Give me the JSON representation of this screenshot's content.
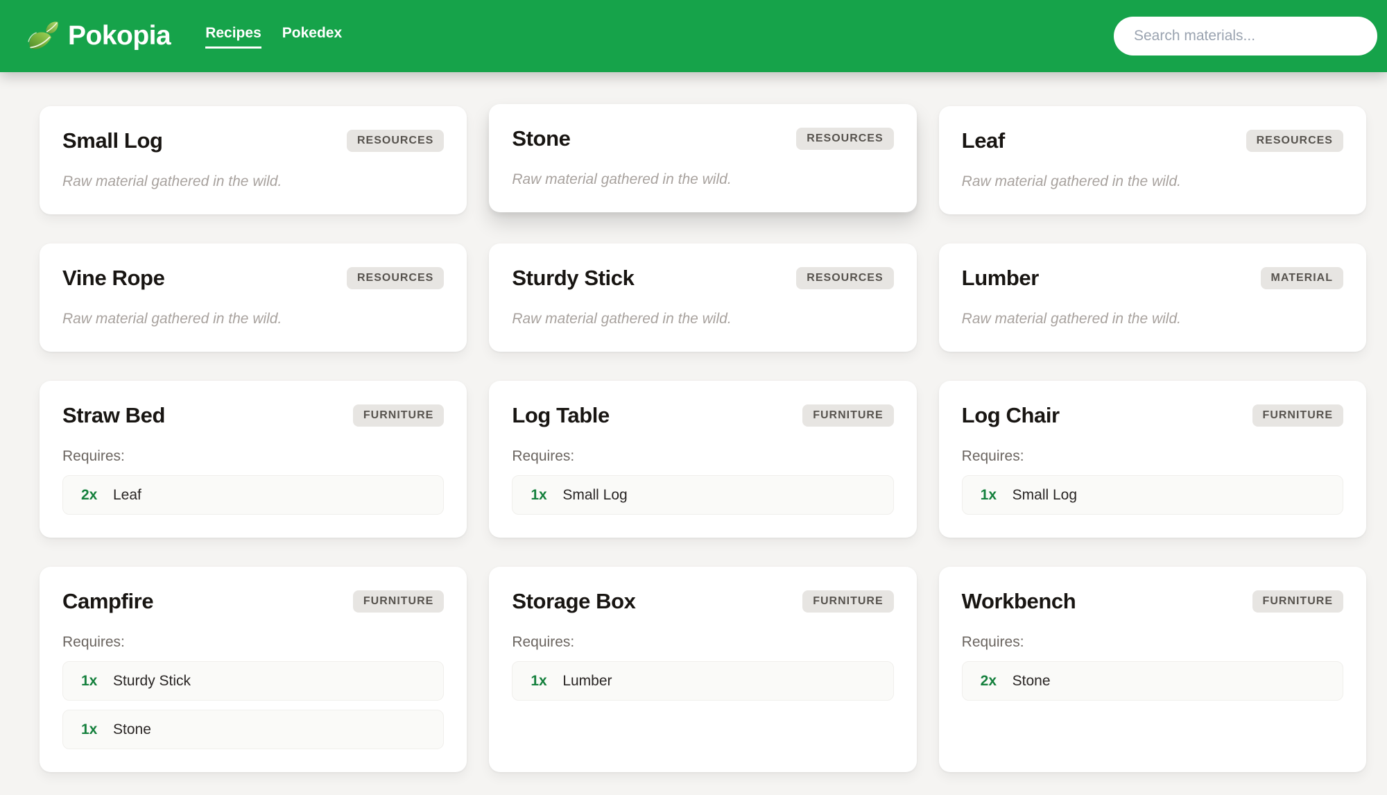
{
  "colors": {
    "accent": "#16a34a",
    "qty_green": "#15803d",
    "page_bg": "#f5f4f2",
    "badge_bg": "#e7e5e2",
    "badge_text": "#57534e"
  },
  "header": {
    "brand": "Pokopia",
    "brand_icon": "leaf-icon",
    "nav": [
      {
        "label": "Recipes",
        "active": true
      },
      {
        "label": "Pokedex",
        "active": false
      }
    ],
    "search": {
      "placeholder": "Search materials..."
    }
  },
  "labels": {
    "requires": "Requires:"
  },
  "cards": [
    {
      "title": "Small Log",
      "badge": "RESOURCES",
      "description": "Raw material gathered in the wild.",
      "hovered": false
    },
    {
      "title": "Stone",
      "badge": "RESOURCES",
      "description": "Raw material gathered in the wild.",
      "hovered": true
    },
    {
      "title": "Leaf",
      "badge": "RESOURCES",
      "description": "Raw material gathered in the wild.",
      "hovered": false
    },
    {
      "title": "Vine Rope",
      "badge": "RESOURCES",
      "description": "Raw material gathered in the wild.",
      "hovered": false
    },
    {
      "title": "Sturdy Stick",
      "badge": "RESOURCES",
      "description": "Raw material gathered in the wild.",
      "hovered": false
    },
    {
      "title": "Lumber",
      "badge": "MATERIAL",
      "description": "Raw material gathered in the wild.",
      "hovered": false
    },
    {
      "title": "Straw Bed",
      "badge": "FURNITURE",
      "ingredients": [
        {
          "qty": "2x",
          "name": "Leaf"
        }
      ],
      "hovered": false
    },
    {
      "title": "Log Table",
      "badge": "FURNITURE",
      "ingredients": [
        {
          "qty": "1x",
          "name": "Small Log"
        }
      ],
      "hovered": false
    },
    {
      "title": "Log Chair",
      "badge": "FURNITURE",
      "ingredients": [
        {
          "qty": "1x",
          "name": "Small Log"
        }
      ],
      "hovered": false
    },
    {
      "title": "Campfire",
      "badge": "FURNITURE",
      "ingredients": [
        {
          "qty": "1x",
          "name": "Sturdy Stick"
        },
        {
          "qty": "1x",
          "name": "Stone"
        }
      ],
      "hovered": false
    },
    {
      "title": "Storage Box",
      "badge": "FURNITURE",
      "ingredients": [
        {
          "qty": "1x",
          "name": "Lumber"
        }
      ],
      "hovered": false
    },
    {
      "title": "Workbench",
      "badge": "FURNITURE",
      "ingredients": [
        {
          "qty": "2x",
          "name": "Stone"
        }
      ],
      "hovered": false
    }
  ]
}
